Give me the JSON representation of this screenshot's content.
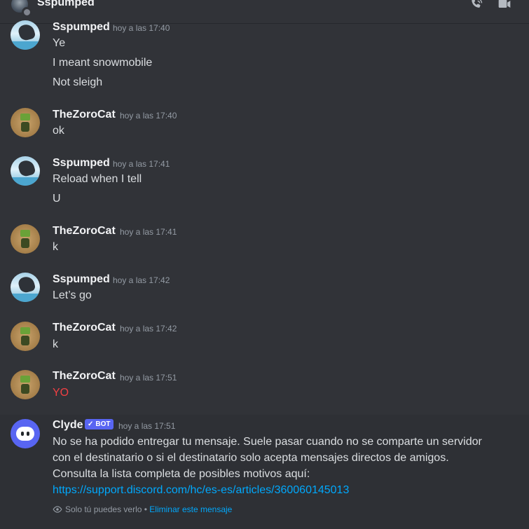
{
  "header": {
    "title": "Sspumped",
    "icons": [
      "phone-call-icon",
      "video-call-icon"
    ]
  },
  "messages": [
    {
      "author": "Sspumped",
      "time": "hoy a las 17:40",
      "lines": [
        "Ye",
        "I meant snowmobile",
        "Not sleigh"
      ]
    },
    {
      "author": "TheZoroCat",
      "time": "hoy a las 17:40",
      "lines": [
        "ok"
      ]
    },
    {
      "author": "Sspumped",
      "time": "hoy a las 17:41",
      "lines": [
        "Reload when I tell",
        "U"
      ]
    },
    {
      "author": "TheZoroCat",
      "time": "hoy a las 17:41",
      "lines": [
        "k"
      ]
    },
    {
      "author": "Sspumped",
      "time": "hoy a las 17:42",
      "lines": [
        "Let’s go"
      ]
    },
    {
      "author": "TheZoroCat",
      "time": "hoy a las 17:42",
      "lines": [
        "k"
      ]
    },
    {
      "author": "TheZoroCat",
      "time": "hoy a las 17:51",
      "lines": [
        "YO"
      ]
    }
  ],
  "clyde": {
    "author": "Clyde",
    "badge": "BOT",
    "time": "hoy a las 17:51",
    "lines": [
      "No se ha podido entregar tu mensaje. Suele pasar cuando no se comparte un servidor",
      "con el destinatario o si el destinatario solo acepta mensajes directos de amigos.",
      "Consulta la lista completa de posibles motivos aquí:"
    ],
    "link": "https://support.discord.com/hc/es-es/articles/360060145013",
    "ephemeral_note": "Solo tú puedes verlo",
    "separator": "•",
    "delete_label": "Eliminar este mensaje"
  },
  "colors": {
    "background": "#313338",
    "link": "#00a8fc",
    "bot_badge": "#5865f2",
    "alert_text": "#f23f43"
  }
}
